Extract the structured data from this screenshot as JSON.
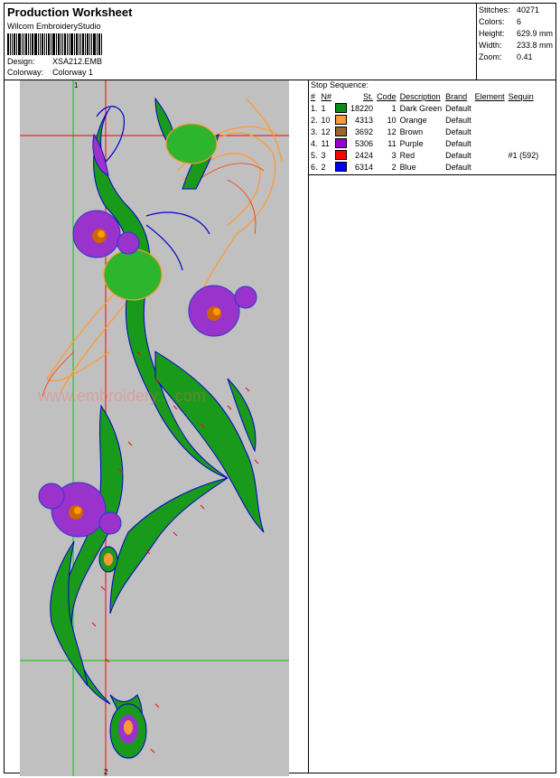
{
  "header": {
    "title": "Production Worksheet",
    "software": "Wilcom EmbroideryStudio",
    "design_label": "Design:",
    "design_value": "XSA212.EMB",
    "colorway_label": "Colorway:",
    "colorway_value": "Colorway 1"
  },
  "stats": [
    {
      "label": "Stitches:",
      "value": "40271"
    },
    {
      "label": "Colors:",
      "value": "6"
    },
    {
      "label": "Height:",
      "value": "629.9 mm"
    },
    {
      "label": "Width:",
      "value": "233.8 mm"
    },
    {
      "label": "Zoom:",
      "value": "0.41"
    }
  ],
  "canvas": {
    "watermark": "www.embroidery....com",
    "marker_top": "1",
    "marker_bottom": "2"
  },
  "sequence": {
    "title": "Stop Sequence:",
    "headers": [
      "#",
      "N#",
      "St.",
      "Code",
      "Description",
      "Brand",
      "Element",
      "Sequin"
    ],
    "rows": [
      {
        "idx": "1.",
        "n": "1",
        "color": "#0d8a1a",
        "st": "18220",
        "code": "1",
        "desc": "Dark Green",
        "brand": "Default",
        "element": "",
        "sequin": ""
      },
      {
        "idx": "2.",
        "n": "10",
        "color": "#ff9933",
        "st": "4313",
        "code": "10",
        "desc": "Orange",
        "brand": "Default",
        "element": "",
        "sequin": ""
      },
      {
        "idx": "3.",
        "n": "12",
        "color": "#996633",
        "st": "3692",
        "code": "12",
        "desc": "Brown",
        "brand": "Default",
        "element": "",
        "sequin": ""
      },
      {
        "idx": "4.",
        "n": "11",
        "color": "#9900cc",
        "st": "5306",
        "code": "11",
        "desc": "Purple",
        "brand": "Default",
        "element": "",
        "sequin": ""
      },
      {
        "idx": "5.",
        "n": "3",
        "color": "#ff0000",
        "st": "2424",
        "code": "3",
        "desc": "Red",
        "brand": "Default",
        "element": "",
        "sequin": "#1 (592)"
      },
      {
        "idx": "6.",
        "n": "2",
        "color": "#0000ff",
        "st": "6314",
        "code": "2",
        "desc": "Blue",
        "brand": "Default",
        "element": "",
        "sequin": ""
      }
    ]
  }
}
